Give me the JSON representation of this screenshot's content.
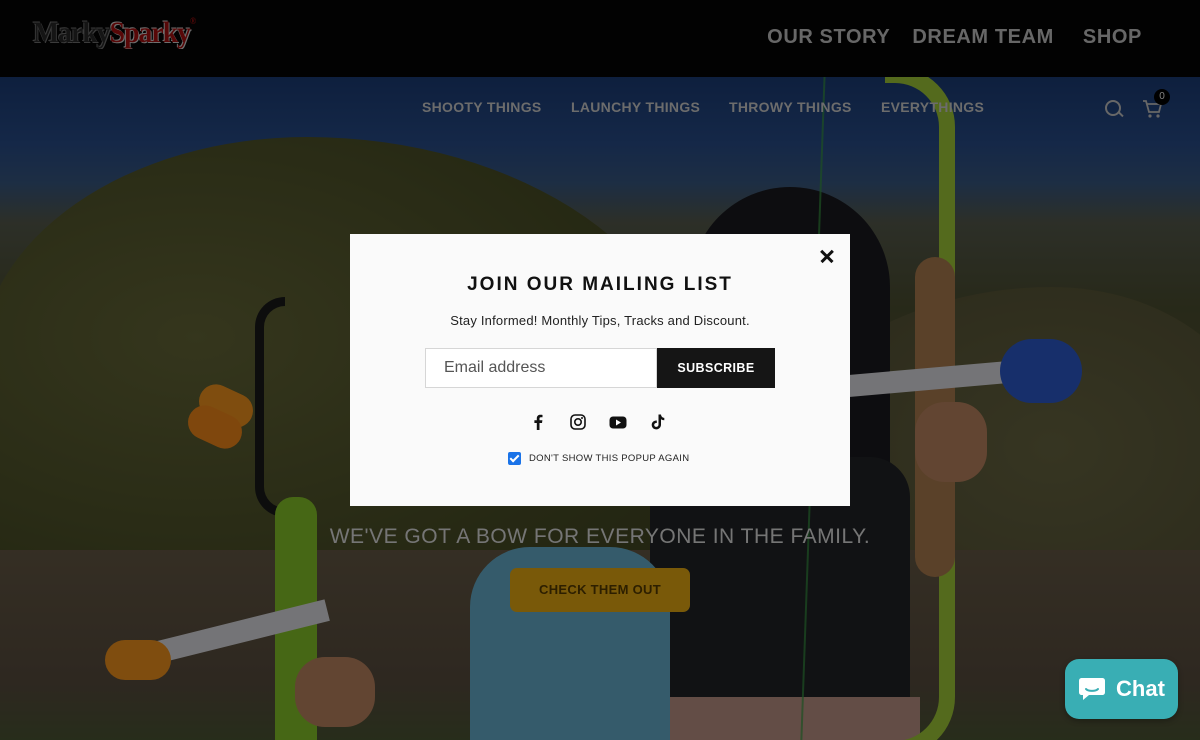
{
  "header": {
    "logo_part1": "Marky",
    "logo_part2": "Sparky",
    "logo_mark": "®",
    "nav": [
      "OUR STORY",
      "DREAM TEAM",
      "SHOP"
    ]
  },
  "subnav": {
    "items": [
      "SHOOTY THINGS",
      "LAUNCHY THINGS",
      "THROWY THINGS",
      "EVERYTHINGS"
    ],
    "cart_count": "0"
  },
  "hero": {
    "tagline": "WE'VE GOT A BOW FOR EVERYONE IN THE FAMILY.",
    "cta_label": "CHECK THEM OUT"
  },
  "popup": {
    "title": "JOIN OUR MAILING LIST",
    "subtitle": "Stay Informed! Monthly Tips, Tracks and Discount.",
    "email_placeholder": "Email address",
    "subscribe_label": "SUBSCRIBE",
    "checkbox_label": "DON'T SHOW THIS POPUP AGAIN",
    "checkbox_checked": true,
    "socials": [
      "facebook-icon",
      "instagram-icon",
      "youtube-icon",
      "tiktok-icon"
    ]
  },
  "chat": {
    "label": "Chat"
  },
  "colors": {
    "cta": "#f2b313",
    "chat": "#39aeb4",
    "logo_red": "#b01010",
    "checkbox": "#1a73e8"
  }
}
